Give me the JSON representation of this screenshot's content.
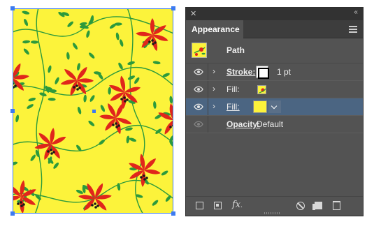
{
  "panel": {
    "tab_label": "Appearance",
    "close_glyph": "✕",
    "collapse_glyph": "‹‹",
    "path_label": "Path",
    "rows": [
      {
        "label": "Stroke:",
        "value": "1 pt",
        "swatch": "stroke-black-white",
        "expandable": true,
        "visible": true
      },
      {
        "label": "Fill:",
        "value": "",
        "swatch": "pattern-swatch",
        "expandable": true,
        "visible": true
      },
      {
        "label": "Fill:",
        "value": "",
        "swatch": "yellow",
        "expandable": true,
        "visible": true,
        "selected": true
      },
      {
        "label": "Opacity:",
        "value": "Default",
        "expandable": false,
        "visible": false
      }
    ],
    "footer": {
      "fx_label": "fx"
    }
  },
  "colors": {
    "pattern_background": "#fcf33b",
    "flower_red": "#e0261b",
    "leaf_green": "#2c9a3c",
    "selection_blue": "#3d7bf0",
    "panel_bg": "#535353",
    "selected_row": "#4b6582"
  }
}
